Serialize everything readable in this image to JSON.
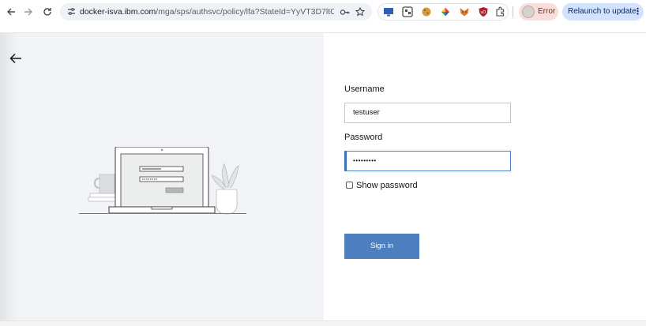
{
  "browser": {
    "url_host": "docker-isva.ibm.com",
    "url_path": "/mga/sps/authsvc/policy/lfa?StateId=YyVT3D7ltCHr...",
    "profile_label": "Error",
    "relaunch_label": "Relaunch to update",
    "icons": {
      "back": "arrow-left-icon",
      "forward": "arrow-right-icon",
      "reload": "reload-icon",
      "site_info": "tune-icon",
      "password_key": "key-icon",
      "bookmark": "star-icon",
      "extensions": "puzzle-icon",
      "menu": "more-vertical-icon"
    },
    "extension_colors": [
      "#2b5fb4",
      "#4a4a4a",
      "#d79a3a",
      "#d8463a",
      "#e2792d",
      "#b3202a"
    ]
  },
  "login": {
    "username_label": "Username",
    "username_value": "testuser",
    "password_label": "Password",
    "password_value": "•••••••••",
    "show_password_label": "Show password",
    "show_password_checked": false,
    "sign_in_label": "Sign in"
  },
  "colors": {
    "primary_button": "#4d7fc0",
    "focus_border": "#3e6fb8",
    "left_panel_bg": "#f2f3f6"
  }
}
